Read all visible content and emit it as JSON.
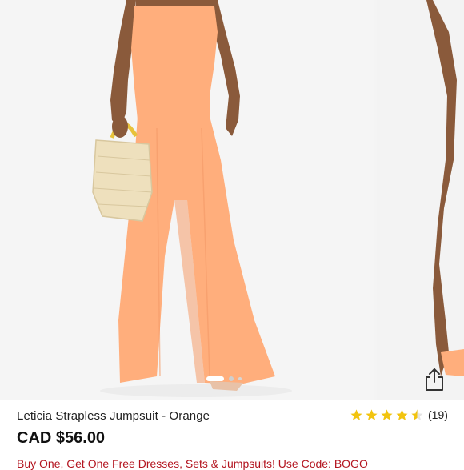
{
  "product": {
    "title": "Leticia Strapless Jumpsuit - Orange",
    "price": "CAD $56.00",
    "rating_value": 4.5,
    "rating_max": 5,
    "reviews_label": "(19)",
    "promo": "Buy One, Get One Free Dresses, Sets & Jumpsuits! Use Code: BOGO"
  },
  "gallery": {
    "image_count": 3,
    "active_index": 0
  },
  "icons": {
    "share": "share-icon",
    "star": "star-icon"
  },
  "colors": {
    "jumpsuit": "#ffae7c",
    "star": "#f2c40f",
    "promo": "#b3141f",
    "bag": "#eee0bd"
  }
}
